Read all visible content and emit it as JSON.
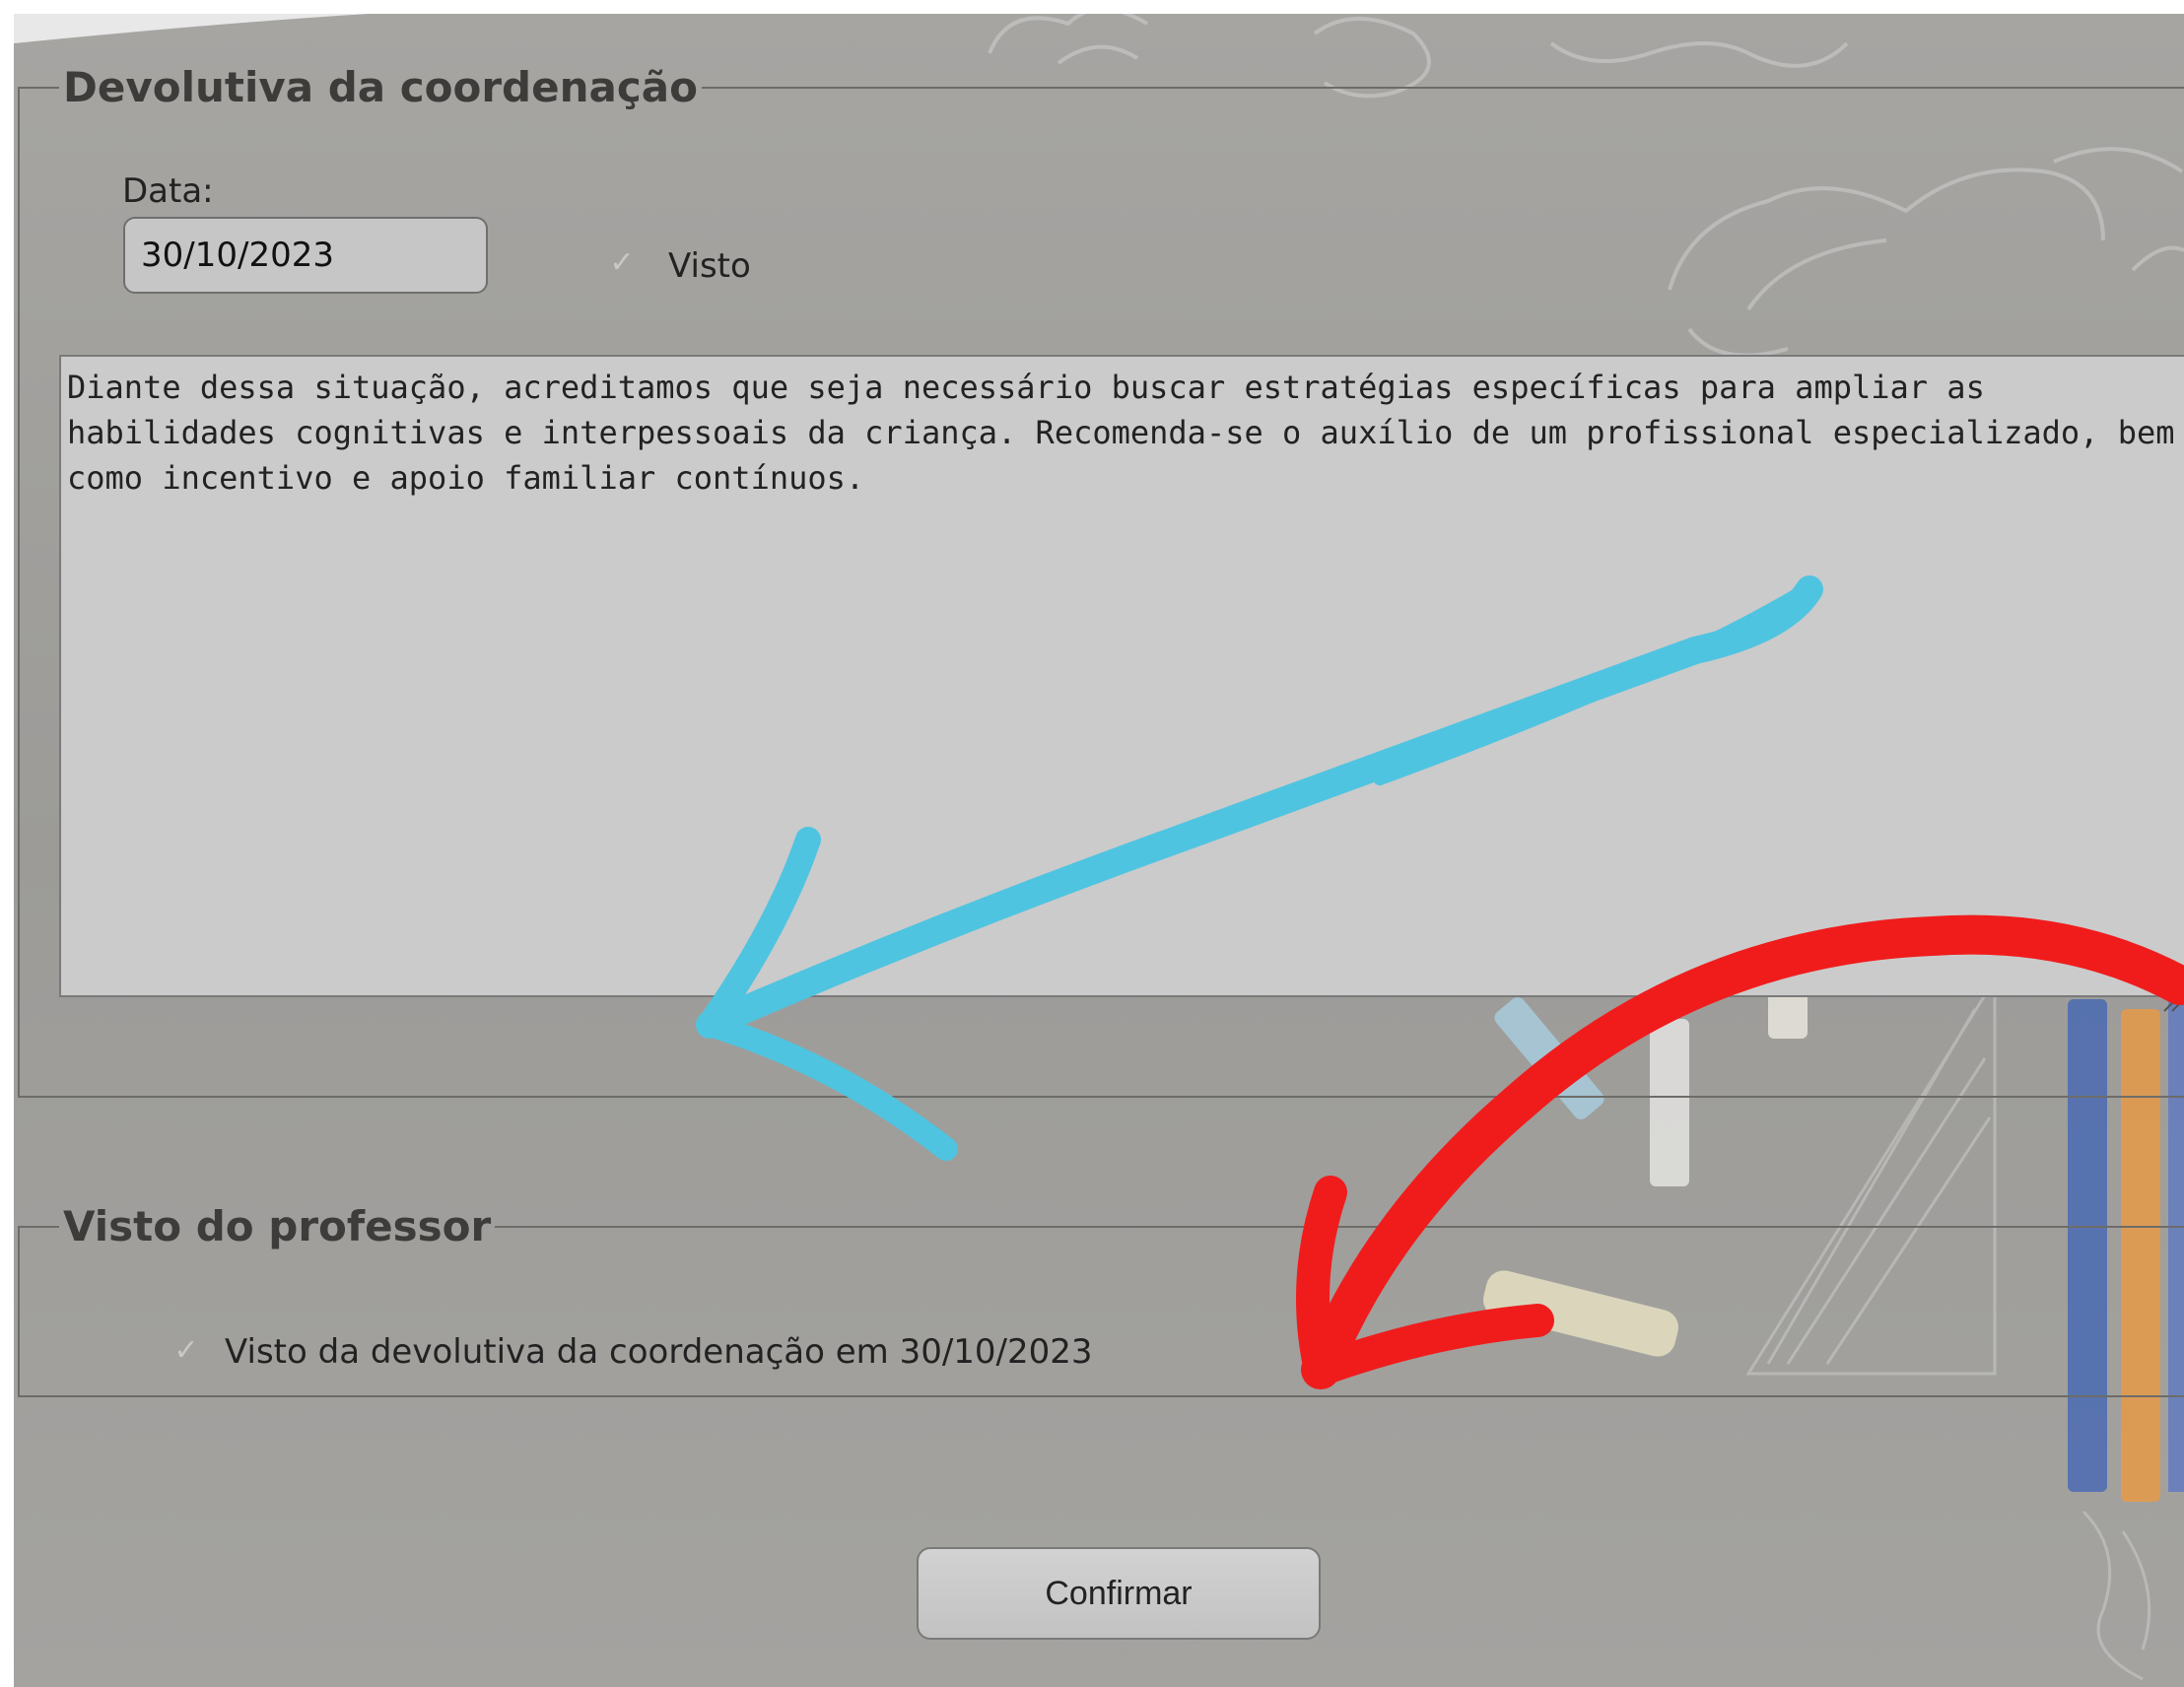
{
  "coordination_feedback": {
    "legend": "Devolutiva da coordenação",
    "date_label": "Data:",
    "date_value": "30/10/2023",
    "seen_label": "Visto",
    "seen_checked": true,
    "feedback_text": "Diante dessa situação, acreditamos que seja necessário buscar estratégias específicas para ampliar as habilidades cognitivas e interpessoais da criança. Recomenda-se o auxílio de um profissional especializado, bem como incentivo e apoio familiar contínuos."
  },
  "teacher_acknowledgement": {
    "legend": "Visto do professor",
    "checkbox_label": "Visto da devolutiva da coordenação em 30/10/2023",
    "checked": true
  },
  "actions": {
    "confirm_label": "Confirmar"
  },
  "colors": {
    "annotation_arrow_blue": "#4fc4e0",
    "annotation_arrow_red": "#f01c1c",
    "background": "#a3a29f"
  },
  "icons": {
    "checkbox_icon": "check-icon",
    "resize_handle": "resize-grip-icon"
  }
}
